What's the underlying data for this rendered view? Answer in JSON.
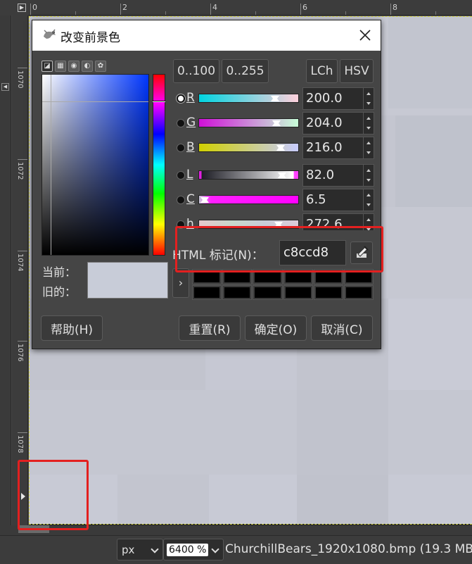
{
  "hruler_labels": [
    "0",
    "2",
    "4",
    "6",
    "8"
  ],
  "vruler_labels": [
    "1070",
    "1072",
    "1074",
    "1076",
    "1078"
  ],
  "dialog": {
    "title": "改变前景色",
    "scale_buttons": [
      "0..100",
      "0..255"
    ],
    "model_buttons": [
      "LCh",
      "HSV"
    ],
    "channels": [
      {
        "label": "R",
        "value": "200.0",
        "checked": true
      },
      {
        "label": "G",
        "value": "204.0",
        "checked": false
      },
      {
        "label": "B",
        "value": "216.0",
        "checked": false
      },
      {
        "label": "L",
        "value": "82.0",
        "checked": false
      },
      {
        "label": "C",
        "value": "6.5",
        "checked": false
      },
      {
        "label": "h",
        "value": "272.6",
        "checked": false
      }
    ],
    "current_label": "当前：",
    "old_label": "旧的：",
    "html_label": "HTML 标记(N)：",
    "html_value": "c8ccd8",
    "buttons": {
      "help": "帮助(H)",
      "reset": "重置(R)",
      "ok": "确定(O)",
      "cancel": "取消(C)"
    }
  },
  "statusbar": {
    "unit": "px",
    "zoom": "6400 %",
    "status_text": "ChurchillBears_1920x1080.bmp (19.3 MB"
  },
  "colors": {
    "foreground": "#c8ccd8",
    "highlight": "#e32020"
  }
}
